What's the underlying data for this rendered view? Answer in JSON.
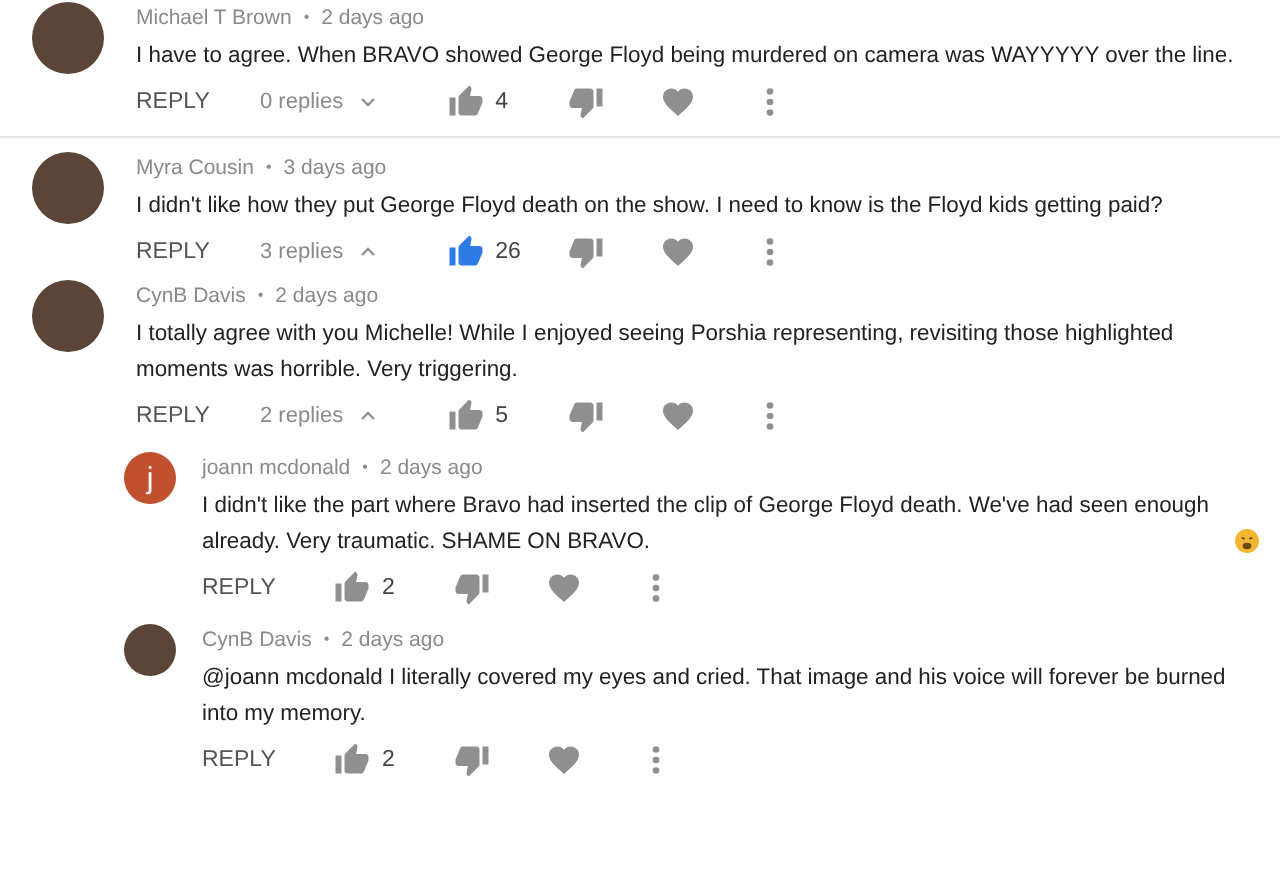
{
  "comments": [
    {
      "author": "Michael T Brown",
      "dot": "•",
      "time": "2 days ago",
      "text": "I have to agree.  When BRAVO showed George Floyd being murdered on camera was WAYYYYY over the line.",
      "avatar": {
        "kind": "photo"
      },
      "reply_label": "REPLY",
      "replies_toggle": {
        "label": "0 replies",
        "expanded": false
      },
      "likes": "4",
      "liked": false,
      "divider": true
    },
    {
      "author": "Myra Cousin",
      "dot": "•",
      "time": "3 days ago",
      "text": "I didn't like how they put George Floyd death on the show. I need to know is the Floyd kids getting paid?",
      "avatar": {
        "kind": "photo"
      },
      "reply_label": "REPLY",
      "replies_toggle": {
        "label": "3 replies",
        "expanded": true
      },
      "likes": "26",
      "liked": true,
      "divider": false
    },
    {
      "author": "CynB Davis",
      "dot": "•",
      "time": "2 days ago",
      "text": "I totally agree with you Michelle! While I enjoyed seeing Porshia representing, revisiting those highlighted moments was horrible. Very triggering.",
      "avatar": {
        "kind": "photo"
      },
      "reply_label": "REPLY",
      "replies_toggle": {
        "label": "2 replies",
        "expanded": true
      },
      "likes": "5",
      "liked": false,
      "divider": false,
      "replies": [
        {
          "author": "joann mcdonald",
          "dot": "•",
          "time": "2 days ago",
          "text": "I didn't like the part where Bravo had inserted the clip of George Floyd death.  We've had seen enough already.  Very traumatic. SHAME ON BRAVO.",
          "emoji": true,
          "avatar": {
            "kind": "letter",
            "letter": "j",
            "color": "#c1502e"
          },
          "reply_label": "REPLY",
          "likes": "2",
          "liked": false
        },
        {
          "author": "CynB Davis",
          "dot": "•",
          "time": "2 days ago",
          "text": "@joann mcdonald I literally covered my eyes and cried. That image and his voice will forever be burned into my memory.",
          "emoji": false,
          "avatar": {
            "kind": "photo"
          },
          "reply_label": "REPLY",
          "likes": "2",
          "liked": false
        }
      ]
    }
  ]
}
